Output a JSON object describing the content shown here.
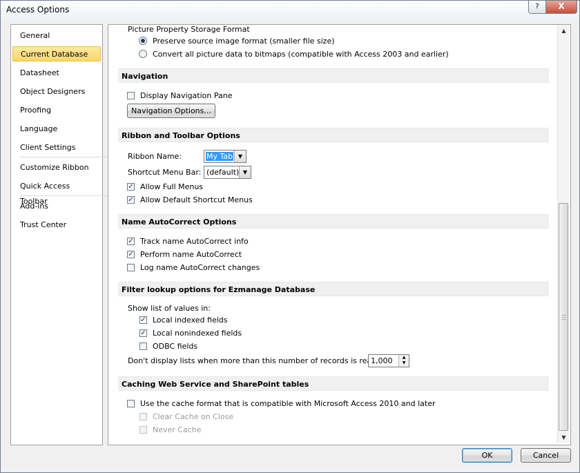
{
  "window": {
    "title": "Access Options",
    "help": "?",
    "close": "X"
  },
  "nav": {
    "items": [
      "General",
      "Current Database",
      "Datasheet",
      "Object Designers",
      "Proofing",
      "Language",
      "Client Settings",
      "Customize Ribbon",
      "Quick Access Toolbar",
      "Add-ins",
      "Trust Center"
    ],
    "selected": "Current Database"
  },
  "picture": {
    "heading": "Picture Property Storage Format",
    "option1": "Preserve source image format (smaller file size)",
    "option2": "Convert all picture data to bitmaps (compatible with Access 2003 and earlier)",
    "selected": "option1"
  },
  "navigation": {
    "header": "Navigation",
    "display_pane": "Display Navigation Pane",
    "display_pane_checked": false,
    "options_button": "Navigation Options..."
  },
  "ribbon": {
    "header": "Ribbon and Toolbar Options",
    "ribbon_name_label": "Ribbon Name:",
    "ribbon_name_value": "My Tab",
    "shortcut_label": "Shortcut Menu Bar:",
    "shortcut_value": "(default)",
    "full_menus": "Allow Full Menus",
    "full_menus_checked": true,
    "default_shortcut": "Allow Default Shortcut Menus",
    "default_shortcut_checked": true
  },
  "autocorrect": {
    "header": "Name AutoCorrect Options",
    "track": "Track name AutoCorrect info",
    "track_checked": true,
    "perform": "Perform name AutoCorrect",
    "perform_checked": true,
    "log": "Log name AutoCorrect changes",
    "log_checked": false
  },
  "filter": {
    "header": "Filter lookup options for Ezmanage Database",
    "show_list": "Show list of values in:",
    "local_indexed": "Local indexed fields",
    "local_indexed_checked": true,
    "local_nonindexed": "Local nonindexed fields",
    "local_nonindexed_checked": true,
    "odbc": "ODBC fields",
    "odbc_checked": false,
    "records_label": "Don't display lists when more than this number of records is read:",
    "records_value": "1,000"
  },
  "caching": {
    "header": "Caching Web Service and SharePoint tables",
    "use_cache": "Use the cache format that is compatible with Microsoft Access 2010 and later",
    "use_cache_checked": false,
    "clear_cache": "Clear Cache on Close",
    "never_cache": "Never Cache"
  },
  "buttons": {
    "ok": "OK",
    "cancel": "Cancel"
  },
  "icons": {
    "check": "✓",
    "dropdown": "▼",
    "scroll_up": "▲",
    "scroll_down": "▼"
  }
}
